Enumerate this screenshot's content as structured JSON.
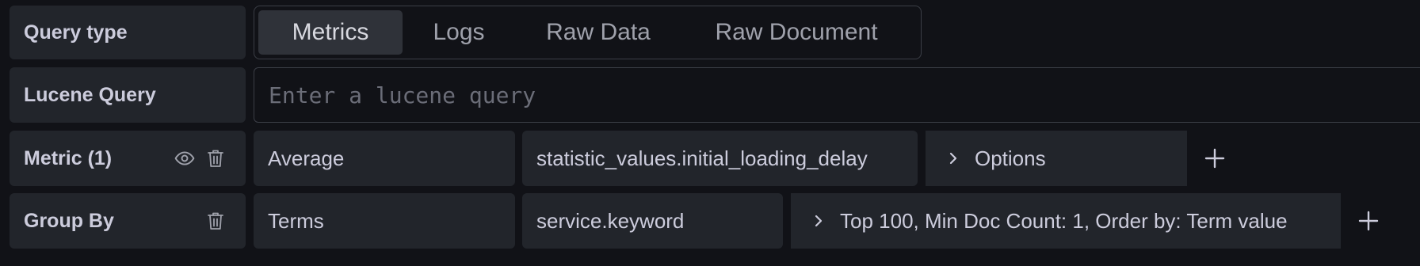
{
  "query_type": {
    "label": "Query type",
    "options": [
      "Metrics",
      "Logs",
      "Raw Data",
      "Raw Document"
    ],
    "selected": "Metrics"
  },
  "lucene": {
    "label": "Lucene Query",
    "placeholder": "Enter a lucene query",
    "value": ""
  },
  "metric": {
    "label": "Metric (1)",
    "aggregation": "Average",
    "field": "statistic_values.initial_loading_delay",
    "options_label": "Options"
  },
  "group_by": {
    "label": "Group By",
    "type": "Terms",
    "field": "service.keyword",
    "settings_summary": "Top 100, Min Doc Count: 1, Order by: Term value"
  },
  "icons": {
    "eye": "eye-icon",
    "trash": "trash-icon",
    "chevron": "chevron-right-icon",
    "plus": "plus-icon"
  },
  "colors": {
    "background": "#111217",
    "panel": "#22252b",
    "border": "#3b3e46",
    "text": "#ccccdc",
    "muted": "#9fa1ab"
  }
}
